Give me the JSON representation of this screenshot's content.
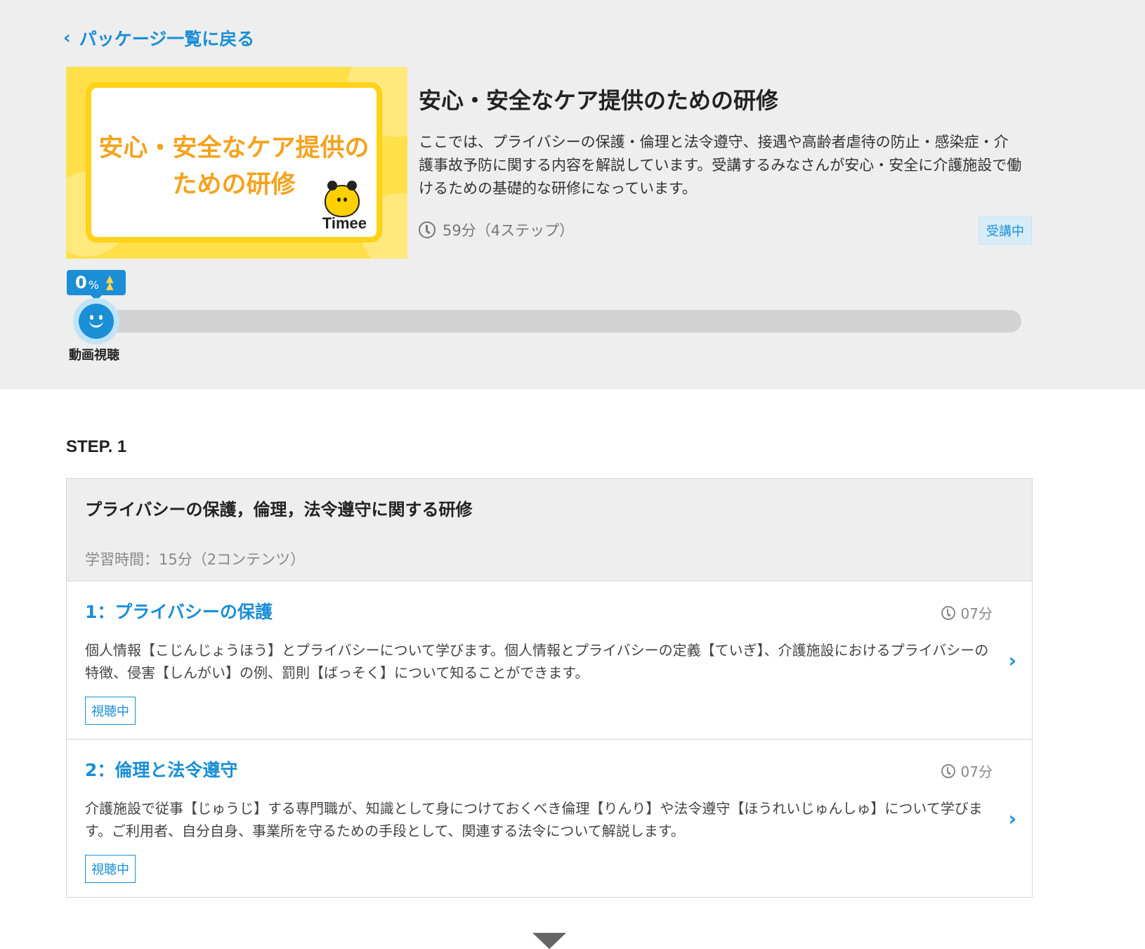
{
  "nav": {
    "back_label": "パッケージ一覧に戻る"
  },
  "course": {
    "thumbnail_title_line1": "安心・安全なケア提供の",
    "thumbnail_title_line2": "ための研修",
    "thumbnail_brand": "Timee",
    "title": "安心・安全なケア提供のための研修",
    "description": "ここでは、プライバシーの保護・倫理と法令遵守、接遇や高齢者虐待の防止・感染症・介護事故予防に関する内容を解説しています。受講するみなさんが安心・安全に介護施設で働けるための基礎的な研修になっています。",
    "duration": "59分（4ステップ）",
    "status": "受講中"
  },
  "progress": {
    "percent_value": "0",
    "percent_unit": "%",
    "fraction": 0,
    "current_label": "動画視聴"
  },
  "step": {
    "heading": "STEP. 1",
    "title": "プライバシーの保護，倫理，法令遵守に関する研修",
    "meta": "学習時間：15分（2コンテンツ）",
    "items": [
      {
        "title": "1：プライバシーの保護",
        "time": "07分",
        "description": "個人情報【こじんじょうほう】とプライバシーについて学びます。個人情報とプライバシーの定義【ていぎ】、介護施設におけるプライバシーの特徴、侵害【しんがい】の例、罰則【ばっそく】について知ることができます。",
        "badge": "視聴中"
      },
      {
        "title": "2：倫理と法令遵守",
        "time": "07分",
        "description": "介護施設で従事【じゅうじ】する専門職が、知識として身につけておくべき倫理【りんり】や法令遵守【ほうれいじゅんしゅ】について学びます。ご利用者、自分自身、事業所を守るための手段として、関連する法令について解説します。",
        "badge": "視聴中"
      }
    ]
  },
  "colors": {
    "accent": "#1a8fd6",
    "thumbnail_bg": "#ffe04a",
    "thumbnail_text": "#f5a21d",
    "hero_bg": "#eeeeee"
  }
}
